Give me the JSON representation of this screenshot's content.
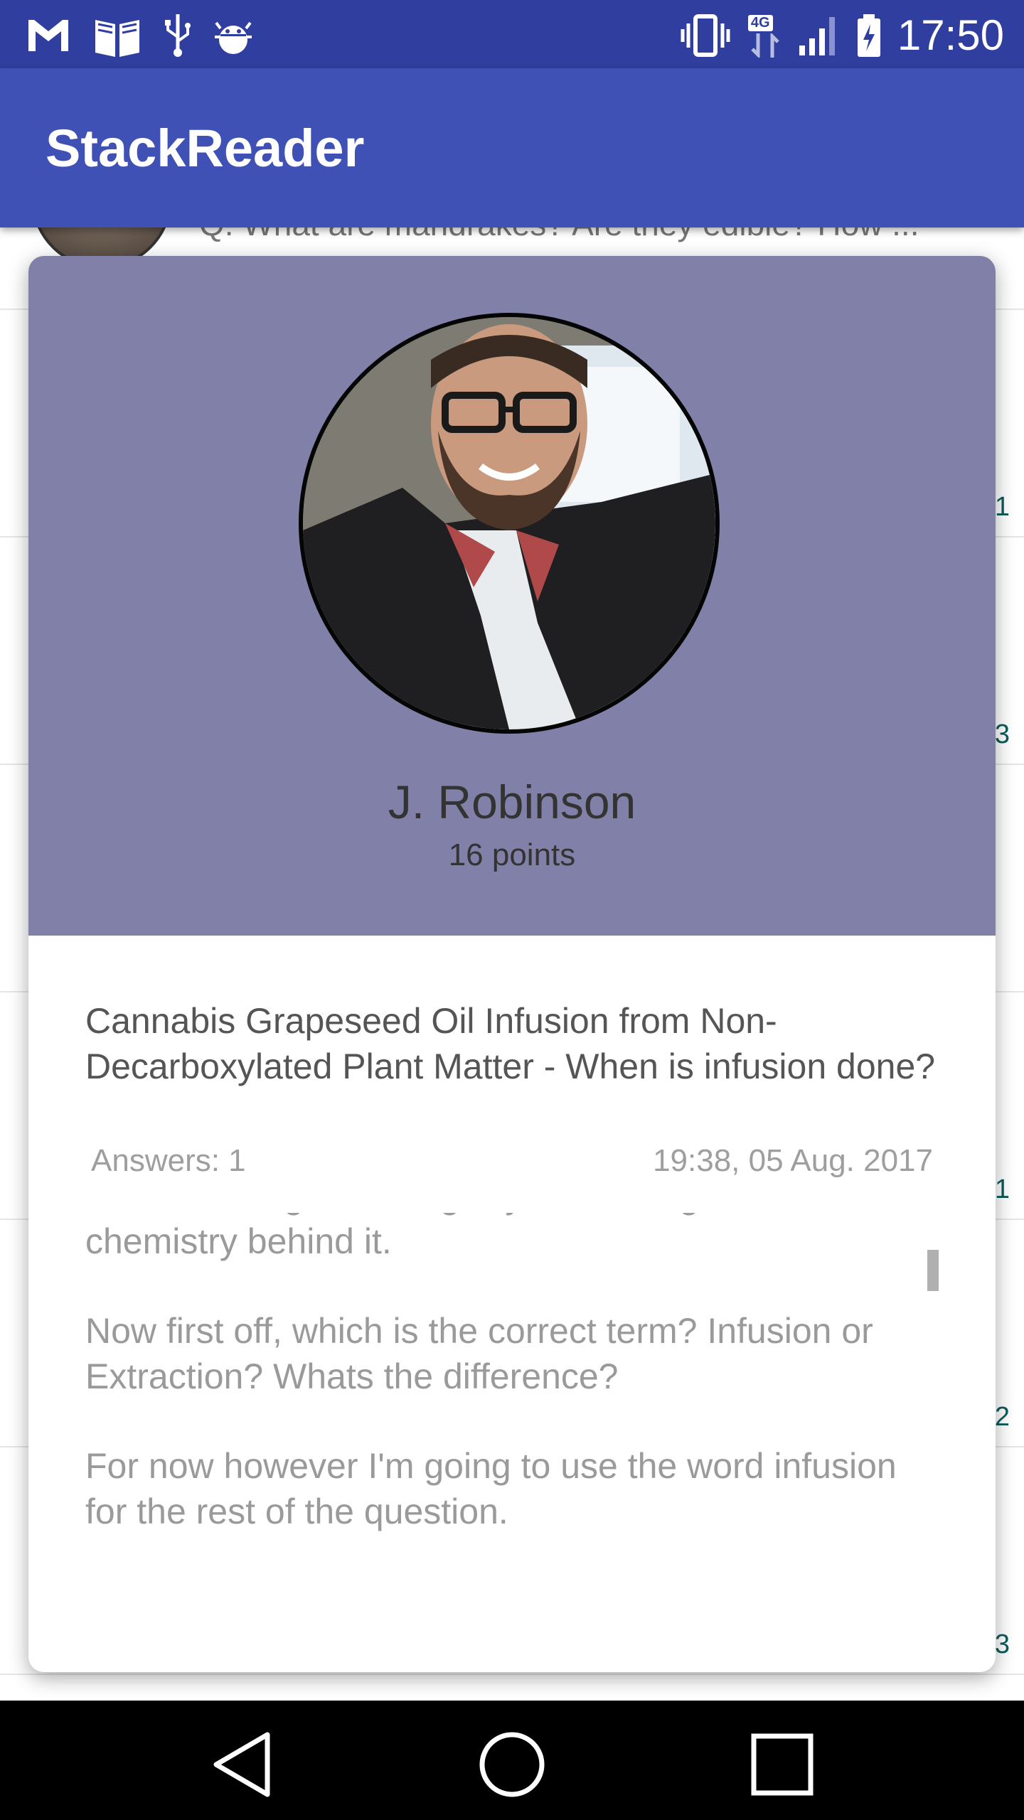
{
  "status_bar": {
    "time": "17:50",
    "network_label": "4G",
    "left_icons": [
      "gmail-icon",
      "books-icon",
      "usb-icon",
      "android-debug-icon"
    ],
    "right_icons": [
      "vibrate-icon",
      "network-4g-icon",
      "signal-icon",
      "battery-charging-icon"
    ]
  },
  "app_bar": {
    "title": "StackReader"
  },
  "background_list": {
    "peek_text": "Q: What are mandrakes? Are they edible? How ...",
    "counts": [
      "1",
      "3",
      "1",
      "2",
      "3"
    ]
  },
  "dialog": {
    "user": {
      "name": "J. Robinson",
      "points": "16 points"
    },
    "question": {
      "title": "Cannabis Grapeseed Oil Infusion from Non-Decarboxylated Plant Matter - When is infusion done?",
      "answers": "Answers: 1",
      "date": "19:38, 05 Aug. 2017",
      "body": [
        "I'm not asking about legality. I'm asking about the chemistry behind it.",
        "Now first off, which is the correct term? Infusion or Extraction? Whats the difference?",
        "For now however I'm going to use the word infusion for the rest of the question."
      ]
    }
  },
  "colors": {
    "status_bar": "#303f9f",
    "app_bar": "#3f51b5",
    "profile_header": "#8080a8",
    "nav_bar": "#000000"
  },
  "nav_bar": {
    "buttons": [
      "back-icon",
      "home-icon",
      "recents-icon"
    ]
  }
}
